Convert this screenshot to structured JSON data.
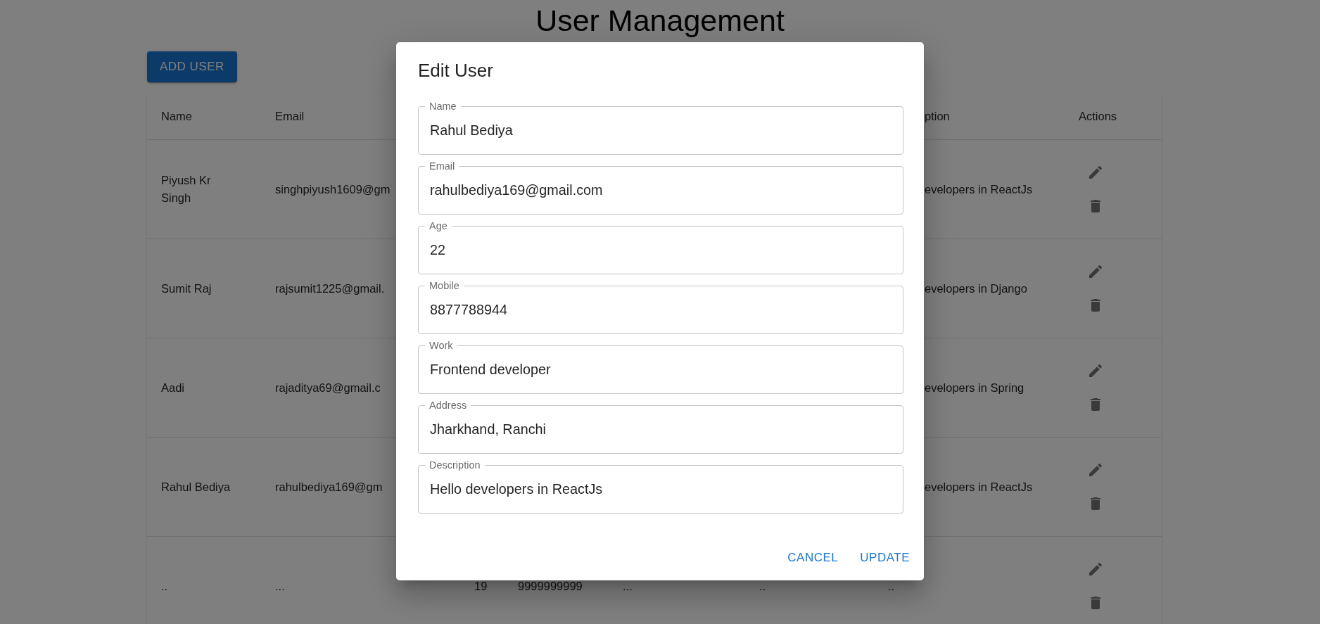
{
  "page": {
    "title": "User Management",
    "add_button": "ADD USER"
  },
  "table": {
    "columns": [
      {
        "label": "Name"
      },
      {
        "label": "Email"
      },
      {},
      {},
      {},
      {},
      {
        "label": "ption"
      },
      {
        "label": "Actions"
      }
    ],
    "rows": [
      {
        "cells": [
          "Piyush Kr Singh",
          "singhpiyush1609@gm",
          null,
          null,
          null,
          null,
          "evelopers in ReactJs"
        ]
      },
      {
        "cells": [
          "Sumit Raj",
          "rajsumit1225@gmail.",
          null,
          null,
          null,
          null,
          "evelopers in Django"
        ]
      },
      {
        "cells": [
          "Aadi",
          "rajaditya69@gmail.c",
          null,
          null,
          null,
          null,
          "evelopers in Spring"
        ]
      },
      {
        "cells": [
          "Rahul Bediya",
          "rahulbediya169@gm",
          null,
          null,
          null,
          null,
          "evelopers in ReactJs"
        ]
      },
      {
        "cells": [
          "..",
          "...",
          "19",
          "9999999999",
          "...",
          "..",
          ".."
        ]
      }
    ]
  },
  "dialog": {
    "title": "Edit User",
    "fields": [
      {
        "label": "Name",
        "value": "Rahul Bediya"
      },
      {
        "label": "Email",
        "value": "rahulbediya169@gmail.com"
      },
      {
        "label": "Age",
        "value": "22"
      },
      {
        "label": "Mobile",
        "value": "8877788944"
      },
      {
        "label": "Work",
        "value": "Frontend developer"
      },
      {
        "label": "Address",
        "value": "Jharkhand, Ranchi"
      },
      {
        "label": "Description",
        "value": "Hello developers in ReactJs"
      }
    ],
    "buttons": [
      "CANCEL",
      "UPDATE"
    ]
  }
}
